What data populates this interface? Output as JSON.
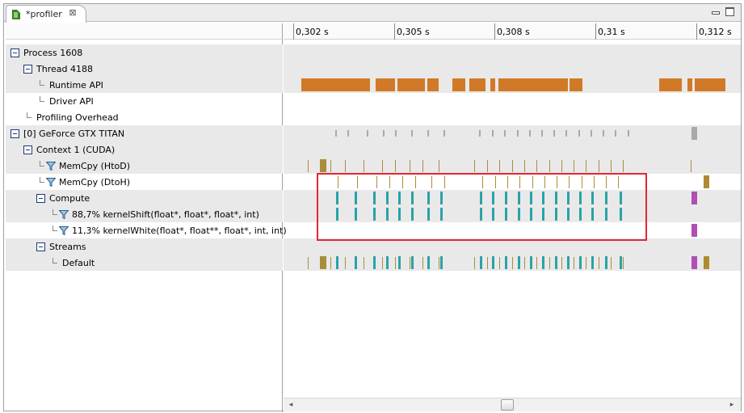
{
  "tab": {
    "title": "*profiler",
    "close_icon": "close-icon",
    "icon": "nvidia-profiler-icon"
  },
  "window_controls": {
    "minimize": "minimize-icon",
    "maximize": "maximize-icon"
  },
  "ruler": {
    "ticks": [
      "0,302 s",
      "0,305 s",
      "0,308 s",
      "0,31 s",
      "0,312 s"
    ]
  },
  "tree": {
    "rows": [
      {
        "label": "Process 1608",
        "kind": "expander",
        "level": 0
      },
      {
        "label": "Thread 4188",
        "kind": "expander",
        "level": 1
      },
      {
        "label": "Runtime API",
        "kind": "leaf",
        "level": 2
      },
      {
        "label": "Driver API",
        "kind": "leaf",
        "level": 2
      },
      {
        "label": "Profiling Overhead",
        "kind": "leaf",
        "level": 1
      },
      {
        "label": "[0] GeForce GTX TITAN",
        "kind": "expander",
        "level": 0
      },
      {
        "label": "Context 1 (CUDA)",
        "kind": "expander",
        "level": 1
      },
      {
        "label": "MemCpy (HtoD)",
        "kind": "filter",
        "level": 2
      },
      {
        "label": "MemCpy (DtoH)",
        "kind": "filter",
        "level": 2
      },
      {
        "label": "Compute",
        "kind": "expander",
        "level": 2
      },
      {
        "label": "88,7% kernelShift(float*, float*, float*, int)",
        "kind": "filter",
        "level": 3
      },
      {
        "label": "11,3% kernelWhite(float*, float**, float*, int, int)",
        "kind": "filter",
        "level": 3
      },
      {
        "label": "Streams",
        "kind": "expander",
        "level": 2
      },
      {
        "label": "Default",
        "kind": "leaf",
        "level": 3
      }
    ]
  },
  "colors": {
    "runtime_api": "#d07a28",
    "overhead": "#a9a9a9",
    "memcpy_htod": "#a88d3c",
    "memcpy_dtoh": "#b08a33",
    "kernel": "#2aa3a6",
    "kernel_white": "#b04eb4",
    "highlight": "#e32636"
  }
}
